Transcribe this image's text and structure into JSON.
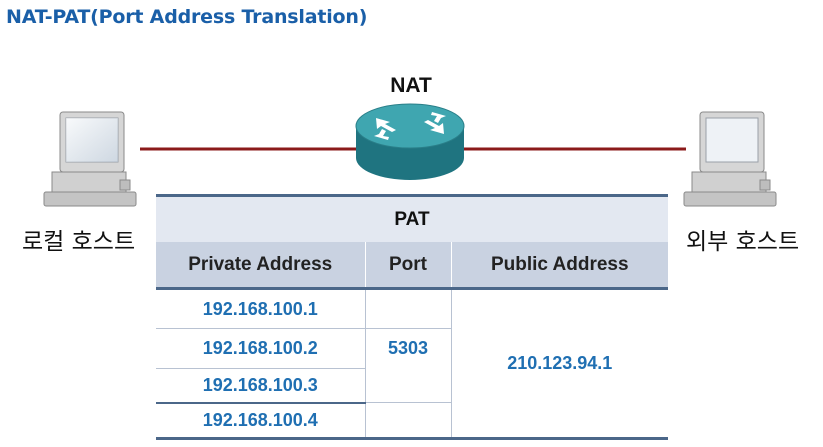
{
  "title": "NAT-PAT(Port Address Translation)",
  "router": {
    "label": "NAT"
  },
  "hosts": {
    "local": "로컬 호스트",
    "remote": "외부 호스트"
  },
  "table": {
    "title": "PAT",
    "headers": [
      "Private Address",
      "Port",
      "Public Address"
    ],
    "private_addresses": [
      "192.168.100.1",
      "192.168.100.2",
      "192.168.100.3",
      "192.168.100.4"
    ],
    "port": "5303",
    "public_address": "210.123.94.1"
  },
  "colors": {
    "title": "#1a5fa8",
    "link": "#8b1a1a",
    "router": "#2b8c96",
    "ip_text": "#1f6fb2",
    "table_border": "#4b6789",
    "header_bg": "#c9d2e1",
    "title_bg": "#e3e8f1"
  }
}
